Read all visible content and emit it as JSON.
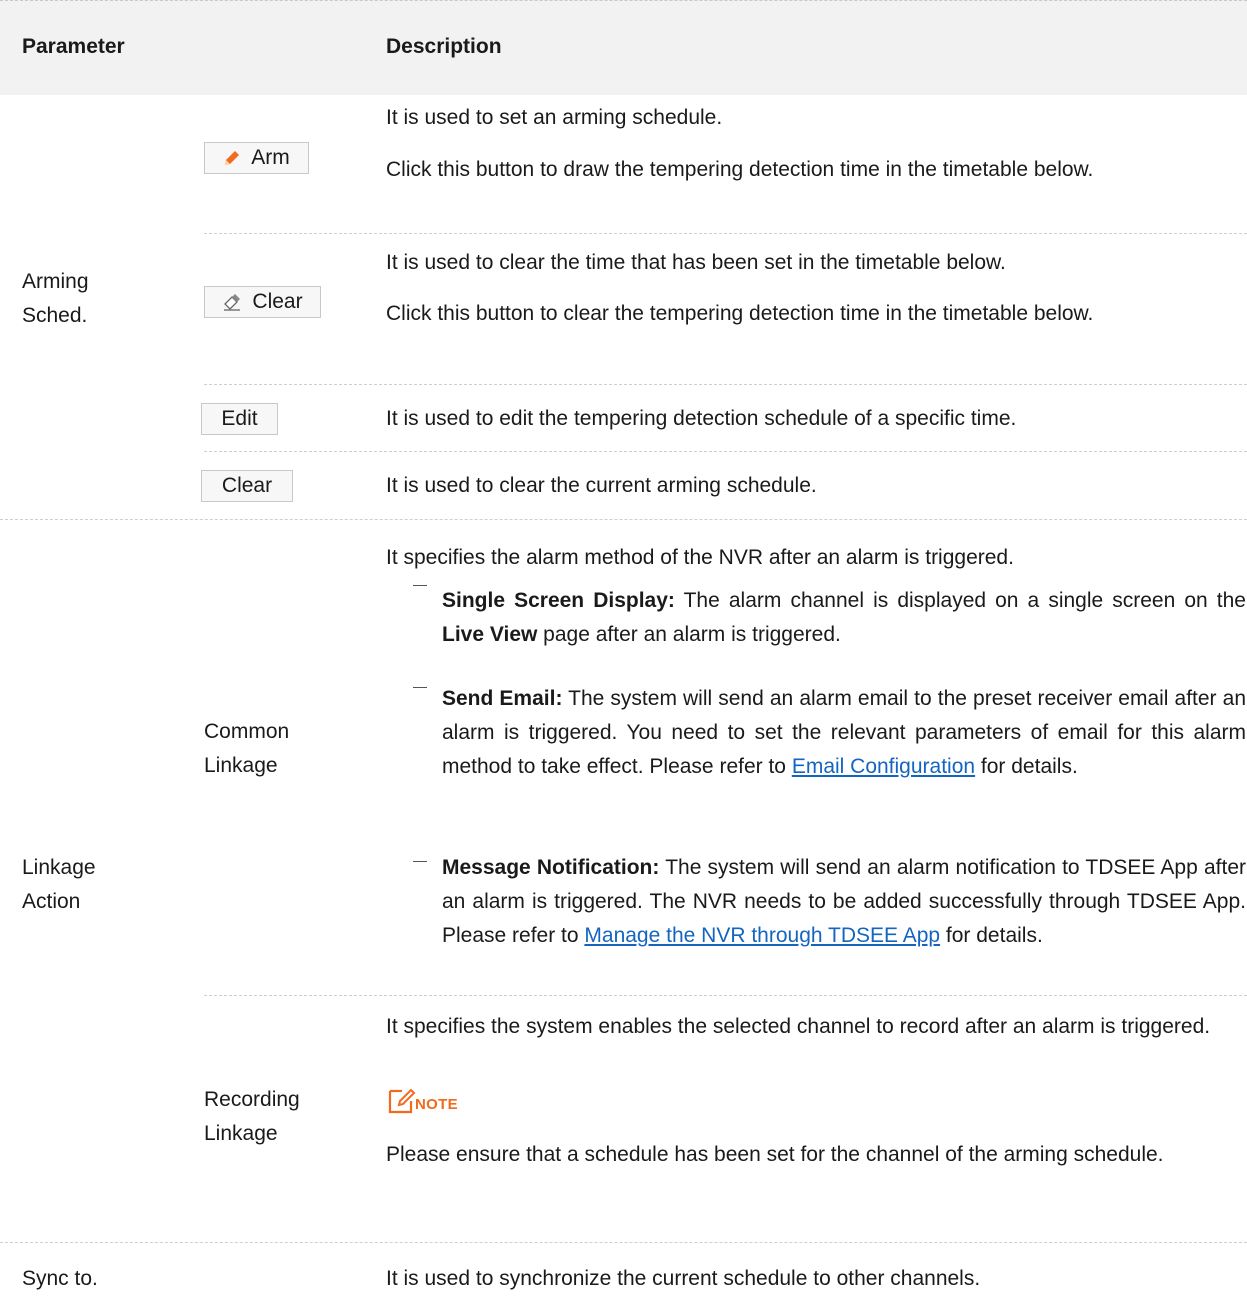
{
  "header": {
    "col1": "Parameter",
    "col2": "Description"
  },
  "arming": {
    "label_line1": "Arming",
    "label_line2": "Sched.",
    "arm": {
      "button": "Arm",
      "desc1": "It is used to set an arming schedule.",
      "desc2": "Click this button to draw the tempering detection time in the timetable below."
    },
    "clear_drawn": {
      "button": "Clear",
      "desc1": "It is used to clear the time that has been set in the timetable below.",
      "desc2": "Click this button to clear the tempering detection time in the timetable below."
    },
    "edit": {
      "button": "Edit",
      "desc": "It is used to edit the tempering detection schedule of a specific time."
    },
    "clear_all": {
      "button": "Clear",
      "desc": "It is used to clear the current arming schedule."
    }
  },
  "linkage": {
    "label_line1": "Linkage",
    "label_line2": "Action",
    "common": {
      "label_line1": "Common",
      "label_line2": "Linkage",
      "intro": "It specifies the alarm method of the NVR after an alarm is triggered.",
      "single_screen": {
        "title": "Single Screen Display:",
        "text_a": " The alarm channel is displayed on a single screen on the ",
        "bold": "Live View",
        "text_b": " page after an alarm is triggered."
      },
      "send_email": {
        "title": "Send Email:",
        "text_a": " The system will send an alarm email to the preset receiver email after an alarm is triggered. You need to set the relevant parameters of email for this alarm method to take effect. Please refer to ",
        "link": "Email Configuration",
        "text_b": " for details."
      },
      "message": {
        "title": "Message Notification:",
        "text_a": " The system will send an alarm notification to TDSEE App after an alarm is triggered. The NVR needs to be added successfully through TDSEE App. Please refer to ",
        "link": "Manage the NVR through TDSEE App",
        "text_b": " for details."
      }
    },
    "recording": {
      "label_line1": "Recording",
      "label_line2": "Linkage",
      "desc": "It specifies the system enables the selected channel to record after an alarm is triggered.",
      "note_label": "NOTE",
      "note_text": "Please ensure that a schedule has been set for the channel of the arming schedule."
    }
  },
  "sync": {
    "label": "Sync to.",
    "desc": "It is used to synchronize the current schedule to other channels."
  },
  "colors": {
    "accent": "#f26a1b",
    "link": "#1565c0",
    "header_bg": "#f2f2f2"
  }
}
